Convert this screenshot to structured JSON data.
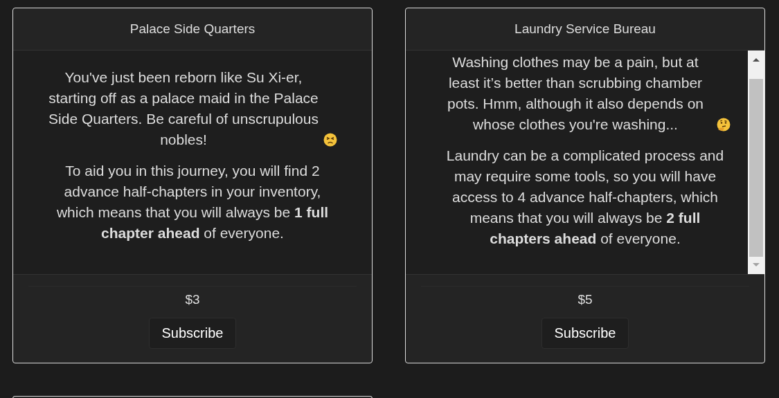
{
  "cards": [
    {
      "title": "Palace Side Quarters",
      "scrollbar": false,
      "paragraphs": [
        {
          "text": "You've just been reborn like Su Xi-er, starting off as a palace maid in the Palace Side Quarters. Be careful of unscrupulous nobles!",
          "icon": true
        },
        {
          "text": "To aid you in this journey, you will find 2 advance half-chapters in your inventory, which means that you will always be **1 full chapter ahead** of everyone.",
          "icon": false
        }
      ],
      "price": "$3",
      "button": "Subscribe"
    },
    {
      "title": "Laundry Service Bureau",
      "scrollbar": true,
      "paragraphs": [
        {
          "text": "Washing clothes may be a pain, but at least it’s better than scrubbing chamber pots. Hmm, although it also depends on whose clothes you're washing...",
          "icon": true
        },
        {
          "text": "Laundry can be a complicated process and may require some tools, so you will have access to 4 advance half-chapters, which means that you will always be **2 full chapters ahead** of everyone.",
          "icon": false
        }
      ],
      "price": "$5",
      "button": "Subscribe"
    }
  ]
}
